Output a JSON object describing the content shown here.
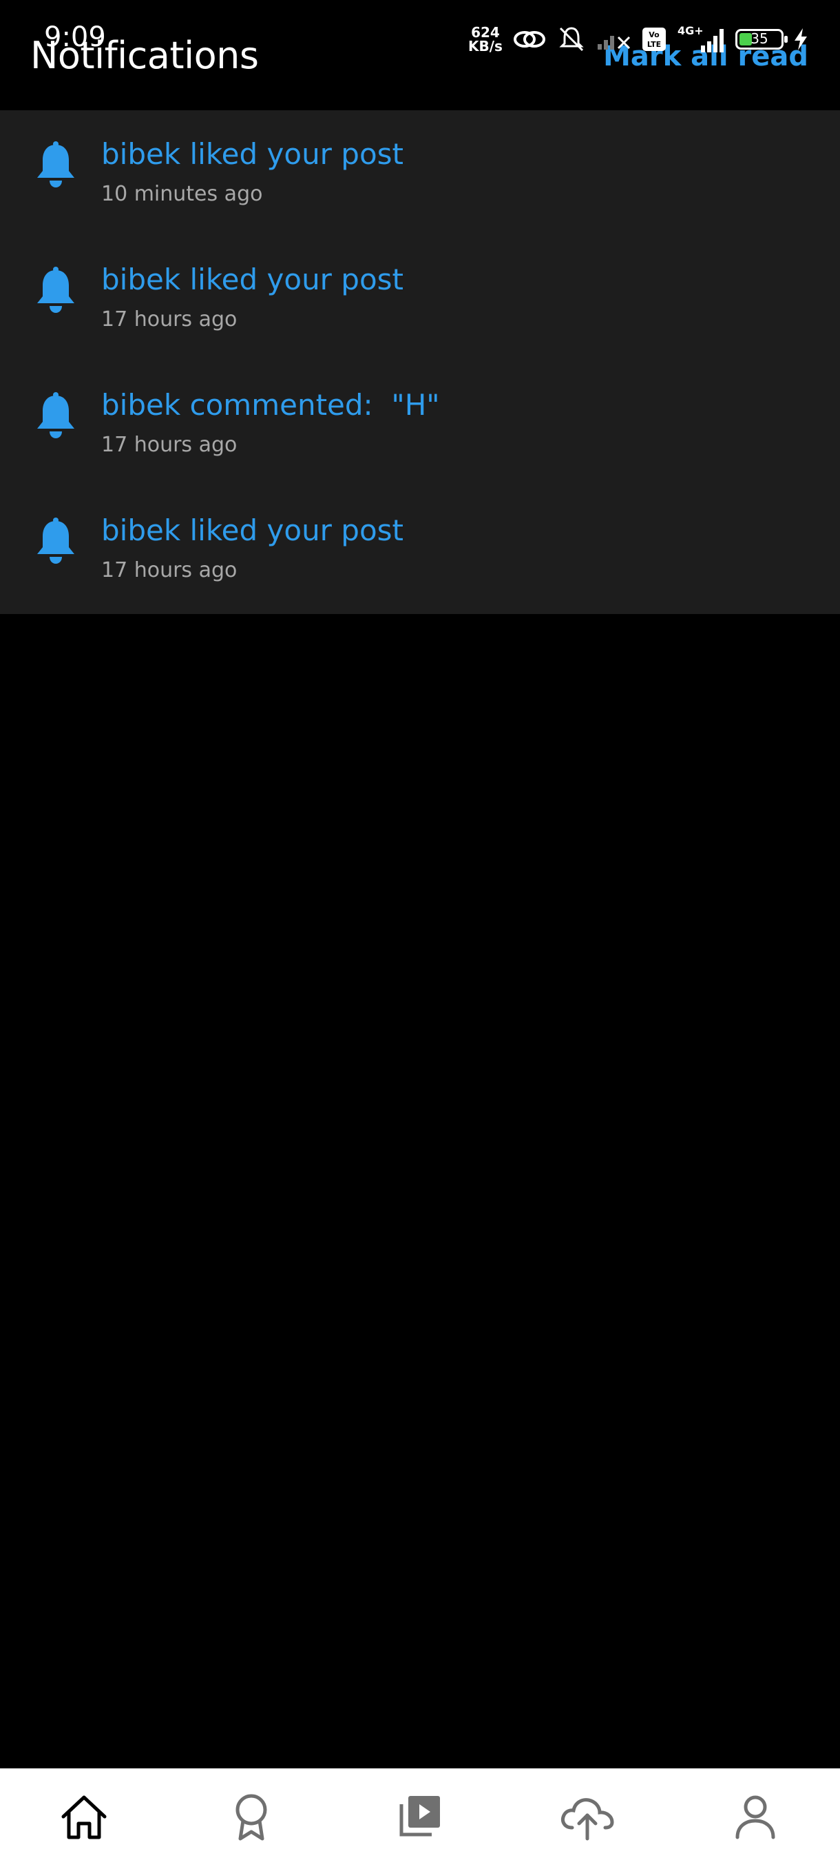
{
  "status_bar": {
    "time": "9:09",
    "net_speed_value": "624",
    "net_speed_unit": "KB/s",
    "network_type": "4G+",
    "volte": "Vo LTE",
    "battery_level": "35"
  },
  "header": {
    "title": "Notifications",
    "mark_all_read": "Mark all read"
  },
  "notifications": [
    {
      "text": "bibek liked your post",
      "time": "10 minutes ago",
      "icon": "bell-icon"
    },
    {
      "text": "bibek liked your post",
      "time": "17 hours ago",
      "icon": "bell-icon"
    },
    {
      "text": "bibek commented:  \"H\"",
      "time": "17 hours ago",
      "icon": "bell-icon"
    },
    {
      "text": "bibek liked your post",
      "time": "17 hours ago",
      "icon": "bell-icon"
    }
  ],
  "bottom_nav": [
    {
      "icon": "home-icon"
    },
    {
      "icon": "award-icon"
    },
    {
      "icon": "video-library-icon"
    },
    {
      "icon": "cloud-upload-icon"
    },
    {
      "icon": "profile-icon"
    }
  ],
  "colors": {
    "accent": "#2f9cec",
    "background": "#000000",
    "panel": "#1d1d1d",
    "timestamp": "#a8a8a8",
    "nav_background": "#ffffff"
  }
}
